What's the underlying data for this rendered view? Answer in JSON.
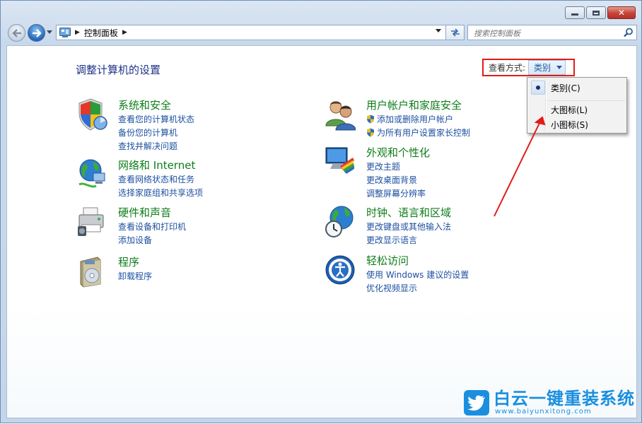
{
  "window": {
    "minimize_icon": "minimize-icon",
    "maximize_icon": "maximize-icon",
    "close_icon": "close-icon"
  },
  "navigation": {
    "breadcrumb_label": "控制面板",
    "search_placeholder": "搜索控制面板"
  },
  "page": {
    "title": "调整计算机的设置",
    "view_by_label": "查看方式:",
    "view_by_value": "类别"
  },
  "view_menu": {
    "items": [
      {
        "label": "类别(C)",
        "checked": true
      },
      {
        "label": "大图标(L)",
        "checked": false
      },
      {
        "label": "小图标(S)",
        "checked": false
      }
    ]
  },
  "categories": [
    {
      "title": "系统和安全",
      "icon": "system-security-icon",
      "links": [
        "查看您的计算机状态",
        "备份您的计算机",
        "查找并解决问题"
      ]
    },
    {
      "title": "网络和 Internet",
      "icon": "network-internet-icon",
      "links": [
        "查看网络状态和任务",
        "选择家庭组和共享选项"
      ]
    },
    {
      "title": "硬件和声音",
      "icon": "hardware-sound-icon",
      "links": [
        "查看设备和打印机",
        "添加设备"
      ]
    },
    {
      "title": "程序",
      "icon": "programs-icon",
      "links": [
        "卸载程序"
      ]
    },
    {
      "title": "用户帐户和家庭安全",
      "icon": "user-accounts-icon",
      "links": [
        "添加或删除用户帐户",
        "为所有用户设置家长控制"
      ]
    },
    {
      "title": "外观和个性化",
      "icon": "appearance-icon",
      "links": [
        "更改主题",
        "更改桌面背景",
        "调整屏幕分辨率"
      ]
    },
    {
      "title": "时钟、语言和区域",
      "icon": "clock-region-icon",
      "links": [
        "更改键盘或其他输入法",
        "更改显示语言"
      ]
    },
    {
      "title": "轻松访问",
      "icon": "ease-of-access-icon",
      "links": [
        "使用 Windows 建议的设置",
        "优化视频显示"
      ]
    }
  ],
  "watermark": {
    "name": "白云一键重装系统",
    "url": "www.baiyunxitong.com"
  },
  "colors": {
    "category_title": "#0e7d1a",
    "link": "#1e50a0",
    "page_title": "#1e3287",
    "highlight_box": "#e21b1b",
    "watermark": "#1a8fe0"
  }
}
